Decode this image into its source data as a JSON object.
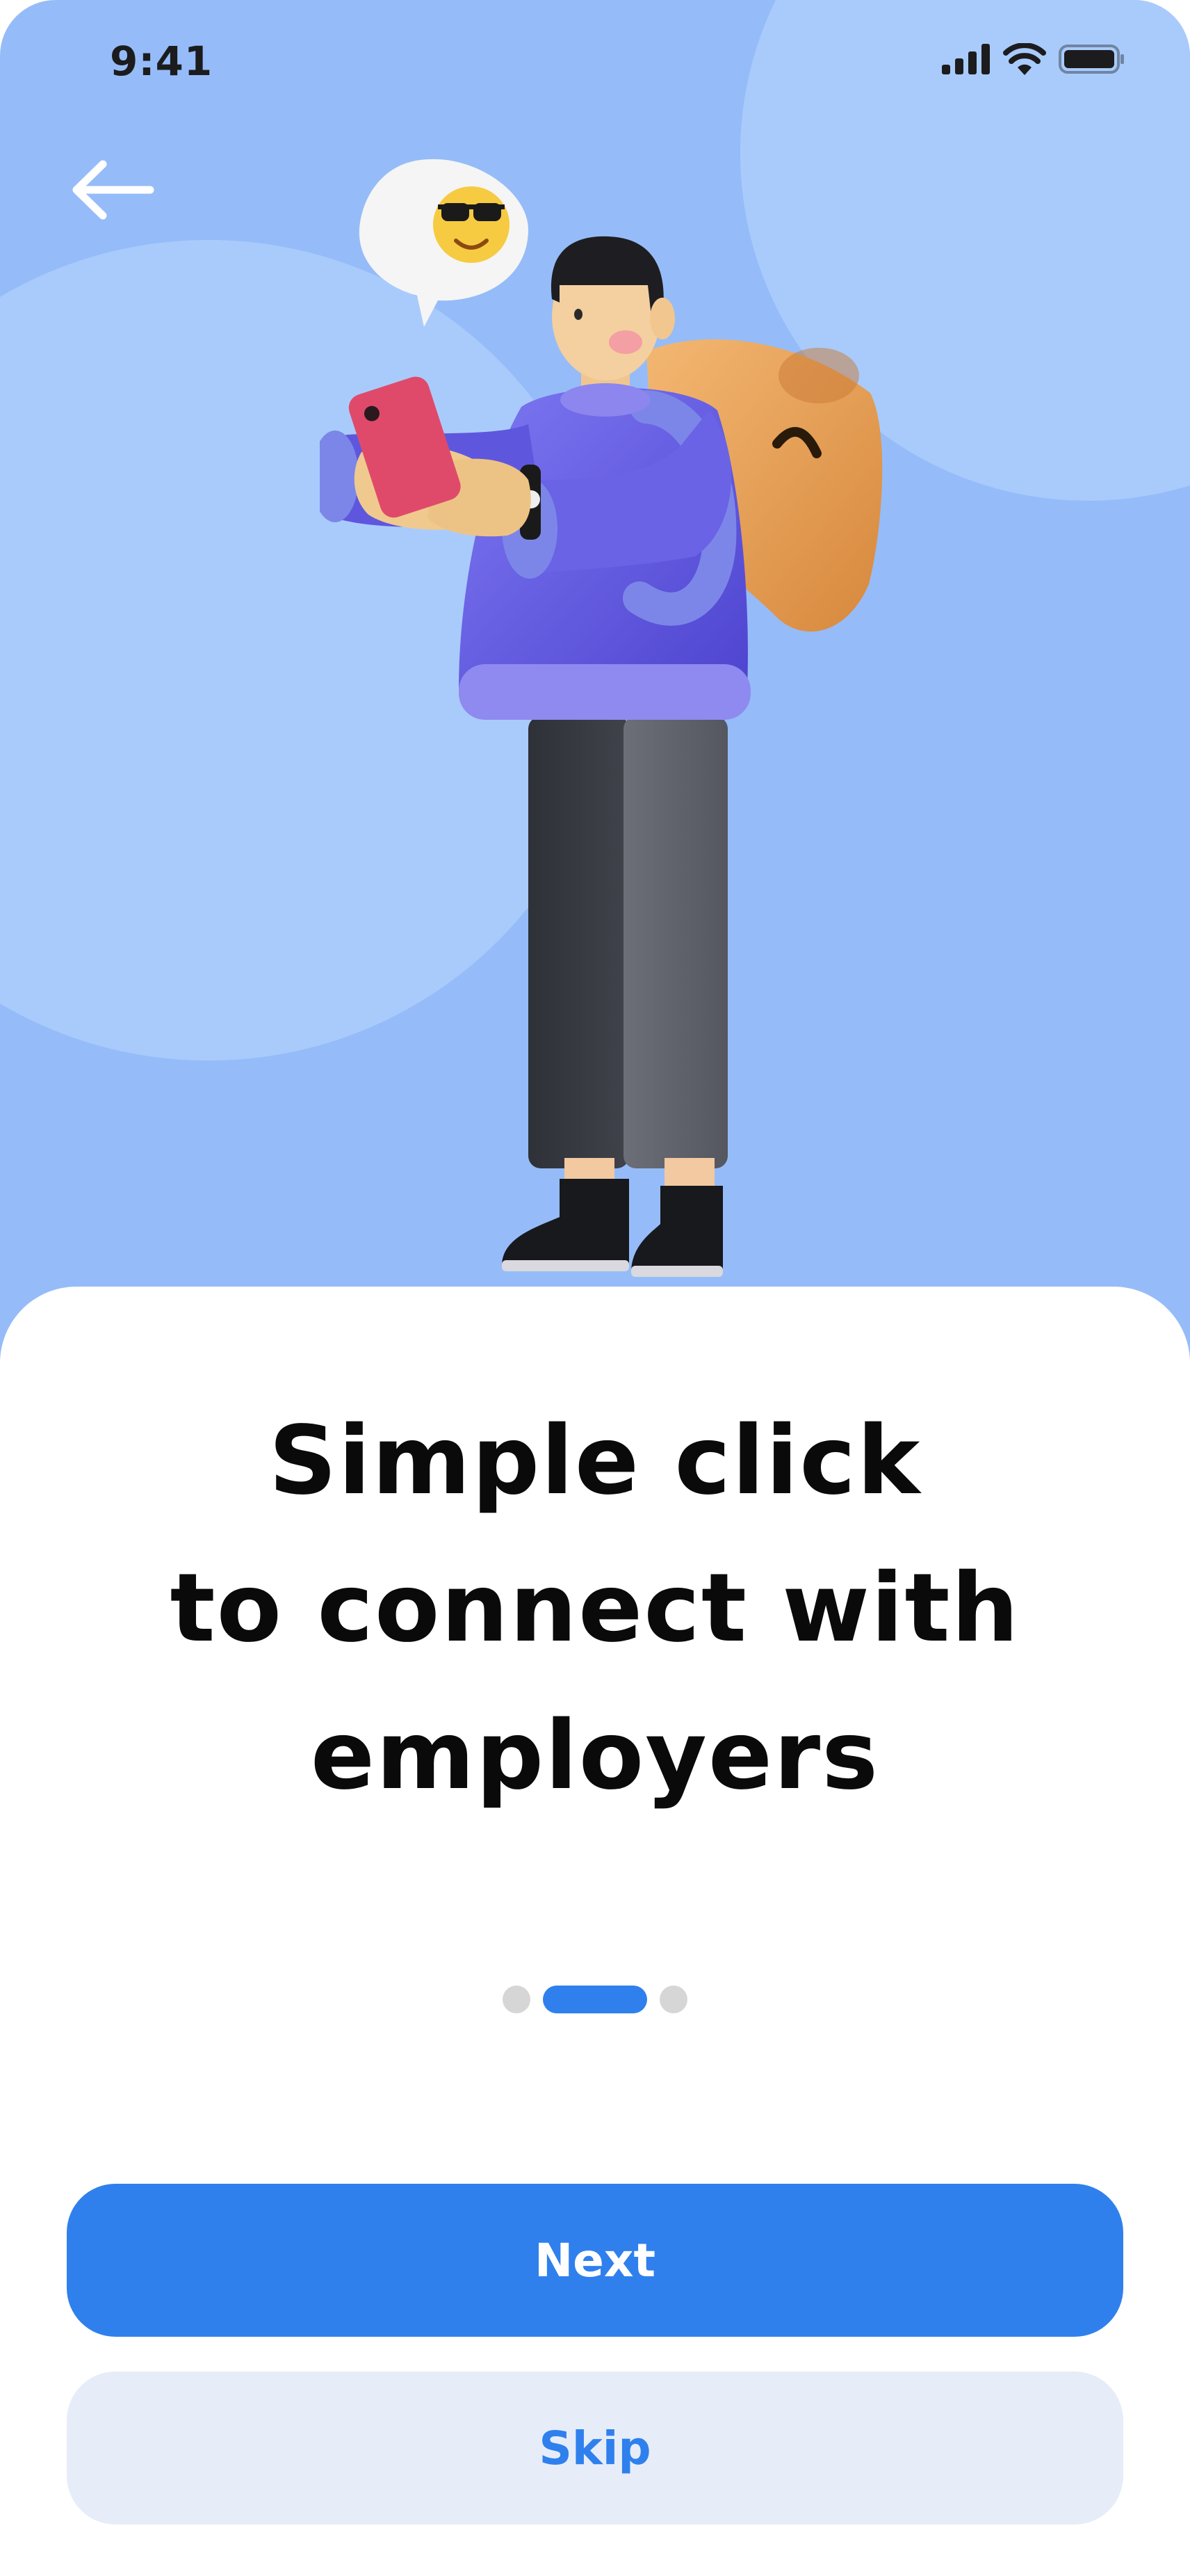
{
  "status_bar": {
    "time": "9:41",
    "icons": [
      "signal-icon",
      "wifi-icon",
      "battery-icon"
    ]
  },
  "header": {
    "back_icon": "arrow-left-icon"
  },
  "illustration": {
    "subject": "person-with-backpack-holding-phone",
    "bubble_emoji": "😎"
  },
  "onboarding": {
    "title_lines": [
      "Simple click",
      "to connect with",
      "employers"
    ],
    "pagination": {
      "total": 3,
      "active": 2
    }
  },
  "actions": {
    "next_label": "Next",
    "skip_label": "Skip"
  },
  "colors": {
    "accent": "#2F80ED",
    "hero_bg": "#95BCF8",
    "hero_circle": "#A9CBFC",
    "skip_bg": "#E6EDF8",
    "dot_inactive": "#D6D6D6"
  }
}
